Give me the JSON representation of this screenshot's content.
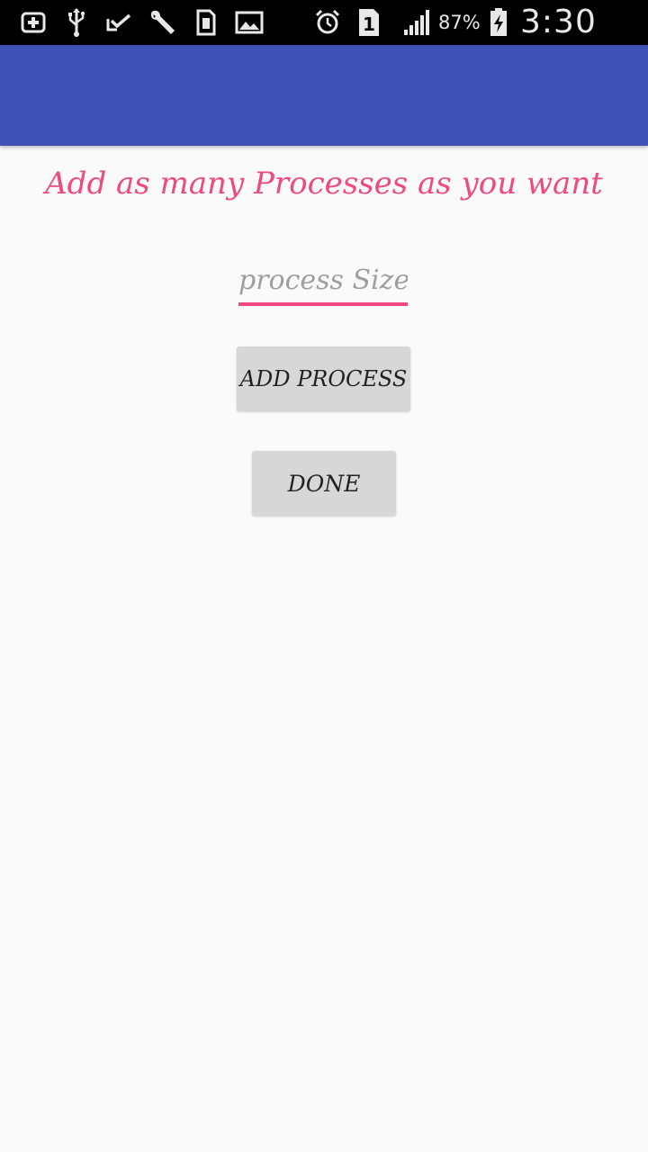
{
  "status_bar": {
    "icons": [
      "plus-box-icon",
      "usb-icon",
      "check-icon",
      "wrench-icon",
      "sim-card-icon",
      "image-icon",
      "alarm-icon",
      "sim-1-icon",
      "signal-icon",
      "battery-charging-icon"
    ],
    "battery_percent": "87%",
    "time": "3:30 AM",
    "sim_slot": "1"
  },
  "app_bar": {
    "color": "#3f51b5"
  },
  "main": {
    "heading": "Add as many Processes as you want",
    "process_size_placeholder": "process Size",
    "process_size_value": "",
    "add_process_label": "ADD PROCESS",
    "done_label": "DONE"
  },
  "colors": {
    "accent": "#ef4a7f",
    "primary": "#3f51b5",
    "button_bg": "#d7d7d7",
    "background": "#fafafa"
  }
}
